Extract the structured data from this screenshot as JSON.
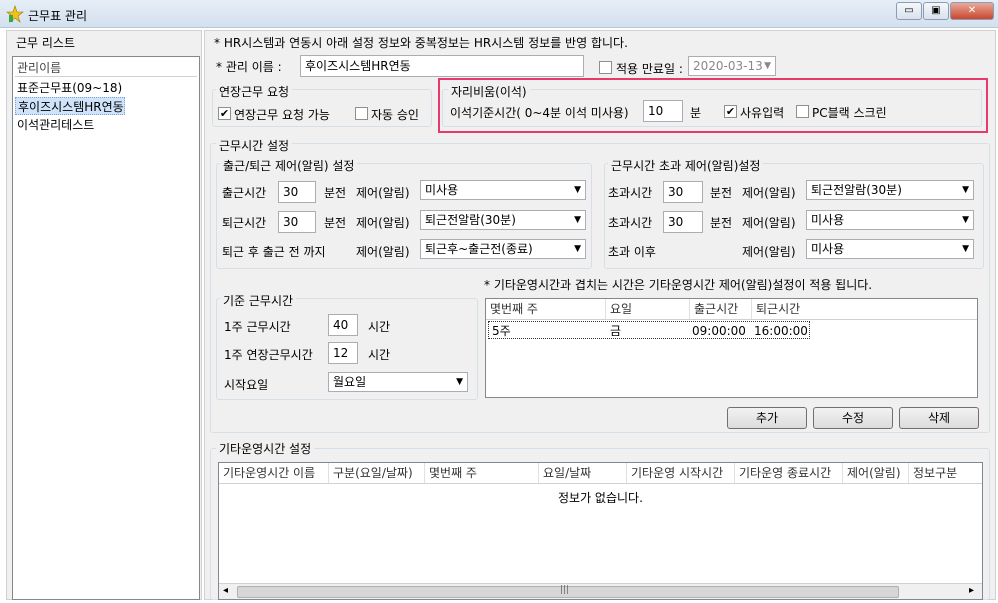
{
  "window": {
    "title": "근무표 관리",
    "btn_min": "▭",
    "btn_max": "▣",
    "btn_close": "✕"
  },
  "sidebar": {
    "title": "근무 리스트",
    "header": "관리이름",
    "items": [
      {
        "label": "표준근무표(09~18)"
      },
      {
        "label": "후이즈시스템HR연동",
        "selected": true
      },
      {
        "label": "이석관리테스트"
      }
    ]
  },
  "notice": "* HR시스템과 연동시 아래 설정 정보와 중복정보는 HR시스템 정보를 반영 합니다.",
  "management": {
    "name_label": "* 관리 이름 :",
    "name_value": "후이즈시스템HR연동",
    "expire_label": "적용 만료일 :",
    "expire_checked": false,
    "expire_value": "2020-03-13"
  },
  "overtime_request": {
    "title": "연장근무 요청",
    "allow_label": "연장근무 요청 가능",
    "allow_checked": true,
    "auto_label": "자동 승인",
    "auto_checked": false
  },
  "away": {
    "title": "자리비움(이석)",
    "base_label": "이석기준시간( 0~4분 이석 미사용)",
    "base_value": "10",
    "unit": "분",
    "reason_label": "사유입력",
    "reason_checked": true,
    "pc_label": "PC블랙 스크린",
    "pc_checked": false
  },
  "worktime": {
    "title": "근무시간 설정",
    "commute": {
      "title": "출근/퇴근 제어(알림) 설정",
      "in_label": "출근시간",
      "in_value": "30",
      "in_unit": "분전",
      "in_ctrl_label": "제어(알림)",
      "in_ctrl_value": "미사용",
      "out_label": "퇴근시간",
      "out_value": "30",
      "out_unit": "분전",
      "out_ctrl_label": "제어(알림)",
      "out_ctrl_value": "퇴근전알람(30분)",
      "after_label": "퇴근 후 출근 전 까지",
      "after_ctrl_label": "제어(알림)",
      "after_ctrl_value": "퇴근후~출근전(종료)"
    },
    "overtime": {
      "title": "근무시간 초과 제어(알림)설정",
      "over1_label": "초과시간",
      "over1_value": "30",
      "over1_unit": "분전",
      "over1_ctrl_label": "제어(알림)",
      "over1_ctrl_value": "퇴근전알람(30분)",
      "over2_label": "초과시간",
      "over2_value": "30",
      "over2_unit": "분전",
      "over2_ctrl_label": "제어(알림)",
      "over2_ctrl_value": "미사용",
      "after_label": "초과 이후",
      "after_ctrl_label": "제어(알림)",
      "after_ctrl_value": "미사용"
    },
    "standard": {
      "title": "기준 근무시간",
      "weekly_label": "1주 근무시간",
      "weekly_value": "40",
      "weekly_unit": "시간",
      "ext_label": "1주 연장근무시간",
      "ext_value": "12",
      "ext_unit": "시간",
      "start_label": "시작요일",
      "start_value": "월요일"
    },
    "other_notice": "* 기타운영시간과 겹치는 시간은 기타운영시간 제어(알림)설정이 적용 됩니다.",
    "week_table": {
      "columns": [
        "몇번째 주",
        "요일",
        "출근시간",
        "퇴근시간"
      ],
      "rows": [
        [
          "5주",
          "금",
          "09:00:00",
          "16:00:00"
        ]
      ]
    },
    "buttons": {
      "add": "추가",
      "edit": "수정",
      "delete": "삭제"
    }
  },
  "other_ops": {
    "title": "기타운영시간 설정",
    "columns": [
      "기타운영시간 이름",
      "구분(요일/날짜)",
      "몇번째 주",
      "요일/날짜",
      "기타운영 시작시간",
      "기타운영 종료시간",
      "제어(알림)",
      "정보구분"
    ],
    "empty": "정보가 없습니다.",
    "scroll_left": "◂",
    "scroll_right": "▸",
    "scroll_grip": "|||"
  },
  "icons": {
    "dropdown": "chevron-down-icon",
    "check": "✔"
  },
  "colors": {
    "highlight": "#e8396d",
    "selection": "#cfe4fa"
  }
}
